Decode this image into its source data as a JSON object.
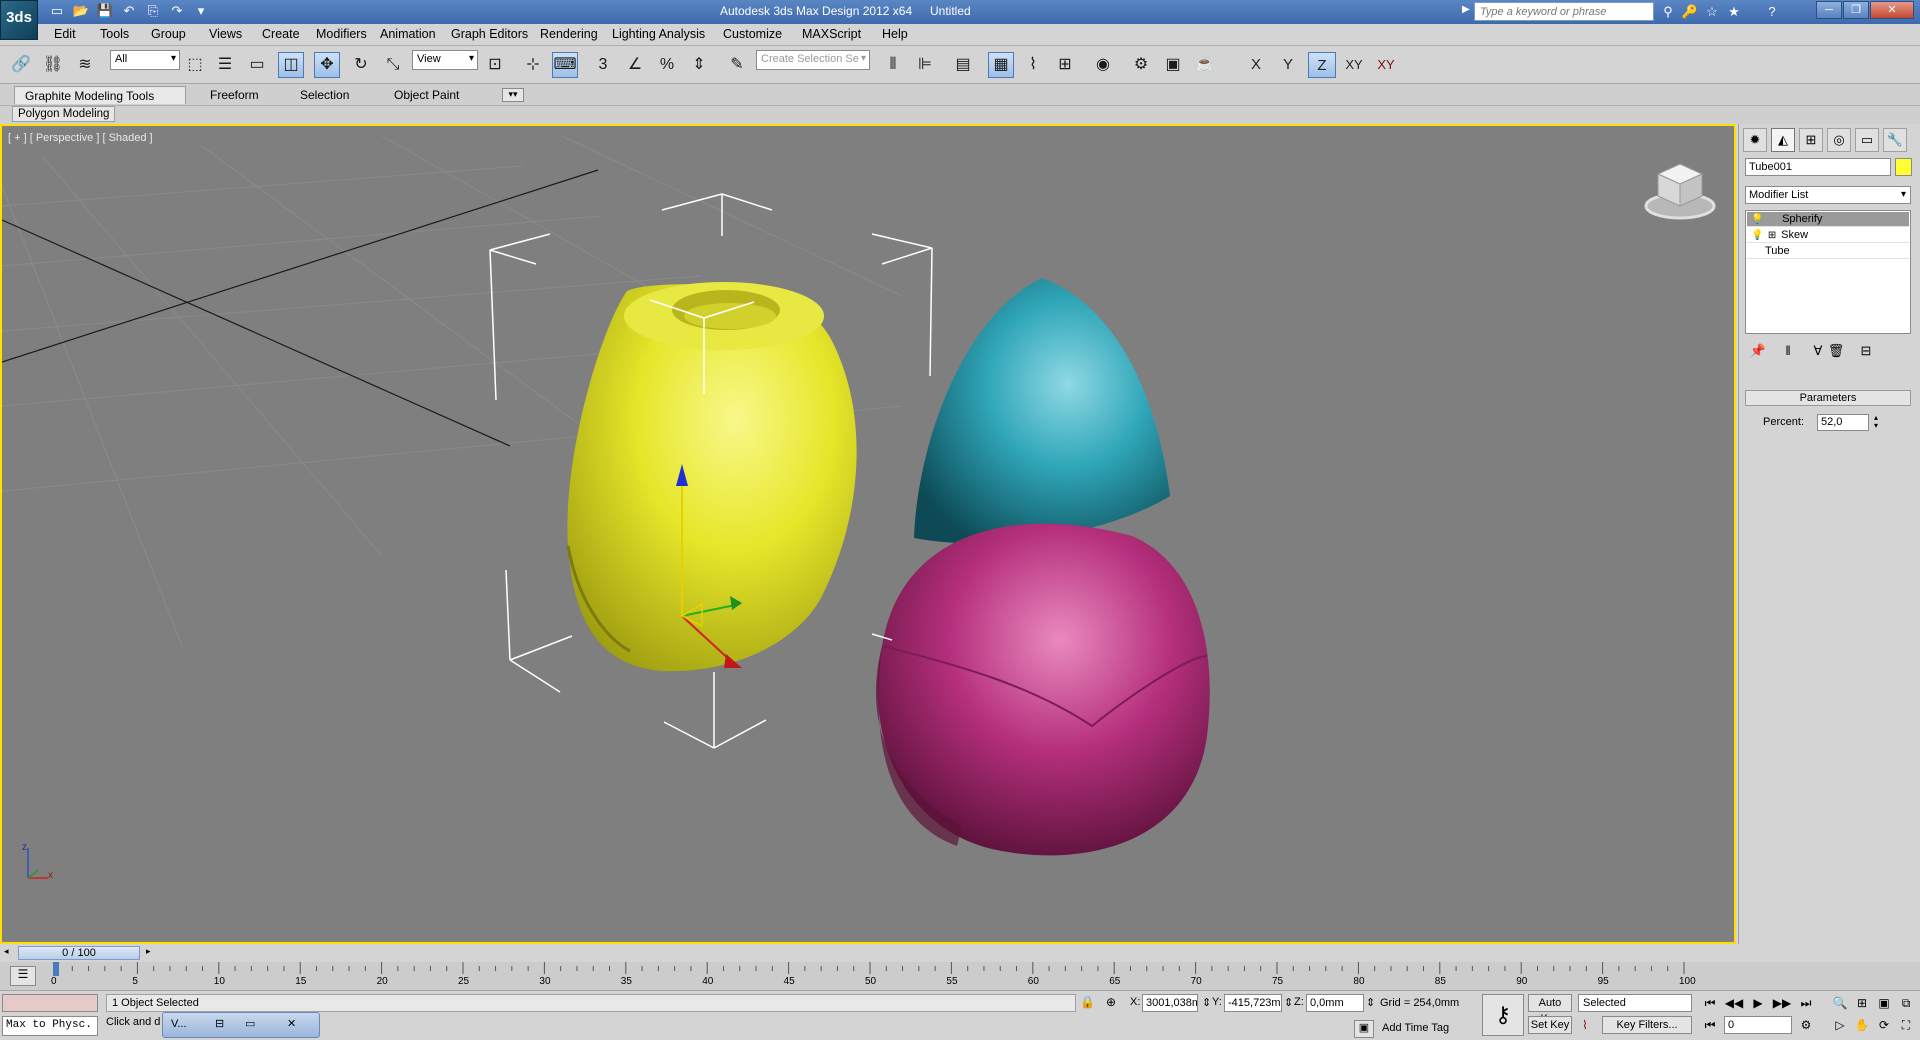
{
  "title": {
    "app": "Autodesk 3ds Max Design 2012 x64",
    "document": "Untitled",
    "logo_text": "3ds",
    "search_placeholder": "Type a keyword or phrase"
  },
  "menu": [
    "Edit",
    "Tools",
    "Group",
    "Views",
    "Create",
    "Modifiers",
    "Animation",
    "Graph Editors",
    "Rendering",
    "Lighting Analysis",
    "Customize",
    "MAXScript",
    "Help"
  ],
  "toolbar": {
    "selection_filter": "All",
    "ref_coord": "View",
    "named_selection_placeholder": "Create Selection Se",
    "axes": [
      "X",
      "Y",
      "Z",
      "XY",
      "XY"
    ],
    "snap_3": "3",
    "snap_pct": "%"
  },
  "ribbon": {
    "tabs": [
      "Graphite Modeling Tools",
      "Freeform",
      "Selection",
      "Object Paint"
    ],
    "panel": "Polygon Modeling"
  },
  "viewport": {
    "label": "[ + ] [ Perspective ] [ Shaded ]",
    "cube_label": "TOP FRONT",
    "axis_z": "z",
    "axis_x": "x",
    "axis_y": "y"
  },
  "command_panel": {
    "object_name": "Tube001",
    "object_color": "#ffff33",
    "modifier_list": "Modifier List",
    "stack": [
      "Spherify",
      "Skew",
      "Tube"
    ],
    "rollout": "Parameters",
    "percent_label": "Percent:",
    "percent_value": "52,0"
  },
  "time": {
    "slider": "0 / 100",
    "ticks": [
      "0",
      "5",
      "10",
      "15",
      "20",
      "25",
      "30",
      "35",
      "40",
      "45",
      "50",
      "55",
      "60",
      "65",
      "70",
      "75",
      "80",
      "85",
      "90",
      "95",
      "100"
    ]
  },
  "status": {
    "maxscript_text": "Max to Physc.",
    "selected": "1 Object Selected",
    "prompt": "Click and d",
    "float_label": "V...",
    "x_label": "X:",
    "x": "3001,038m",
    "y_label": "Y:",
    "y": "-415,723m",
    "z_label": "Z:",
    "z": "0,0mm",
    "grid": "Grid = 254,0mm",
    "add_time_tag": "Add Time Tag",
    "auto_key": "Auto Key",
    "set_key": "Set Key",
    "key_mode": "Selected",
    "key_filters": "Key Filters...",
    "frame": "0"
  },
  "colors": {
    "viewport_bg": "#7f7f7f",
    "active_border": "#ffde00",
    "tube": "#e6e62a",
    "cyan_object": "#2fa6b8",
    "magenta_object": "#b52f7c"
  }
}
